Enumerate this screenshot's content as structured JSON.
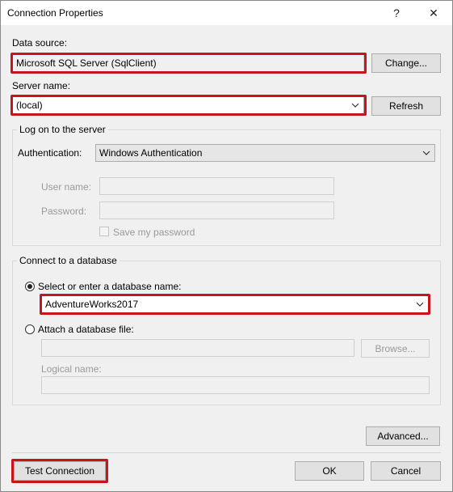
{
  "window": {
    "title": "Connection Properties",
    "help_label": "?",
    "close_label": "✕"
  },
  "data_source": {
    "label": "Data source:",
    "value": "Microsoft SQL Server (SqlClient)",
    "change_label": "Change..."
  },
  "server": {
    "label": "Server name:",
    "value": "(local)",
    "refresh_label": "Refresh"
  },
  "logon": {
    "group_title": "Log on to the server",
    "auth_label": "Authentication:",
    "auth_value": "Windows Authentication",
    "username_label": "User name:",
    "username_value": "",
    "password_label": "Password:",
    "password_value": "",
    "save_password_label": "Save my password"
  },
  "database": {
    "group_title": "Connect to a database",
    "select_label": "Select or enter a database name:",
    "db_value": "AdventureWorks2017",
    "attach_label": "Attach a database file:",
    "attach_value": "",
    "browse_label": "Browse...",
    "logical_label": "Logical name:",
    "logical_value": ""
  },
  "footer": {
    "advanced_label": "Advanced...",
    "test_label": "Test Connection",
    "ok_label": "OK",
    "cancel_label": "Cancel"
  },
  "colors": {
    "highlight": "#c8141c"
  }
}
